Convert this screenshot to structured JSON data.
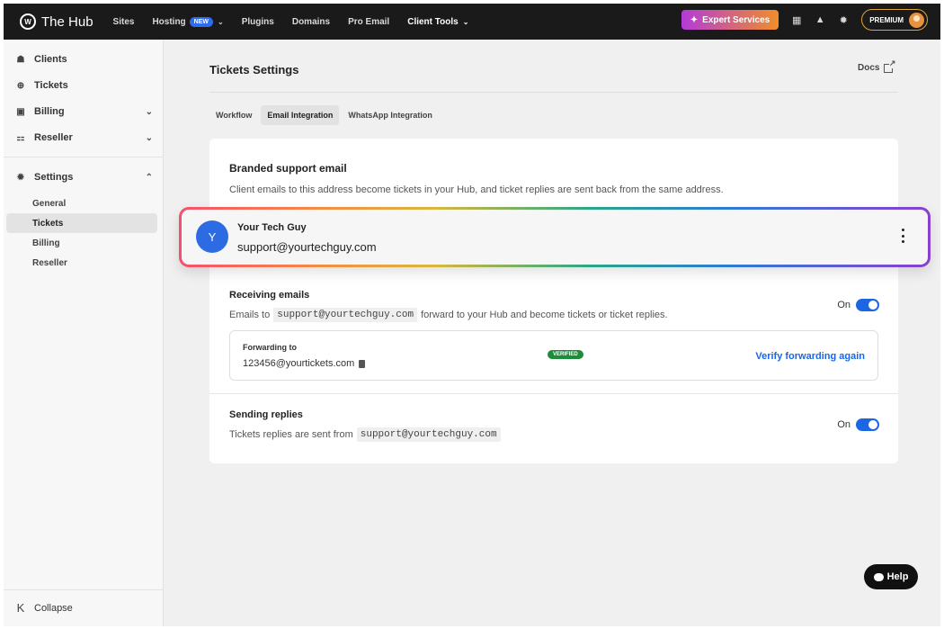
{
  "app": {
    "brand_name": "The Hub",
    "logo_text": "W"
  },
  "topnav": {
    "items": [
      {
        "label": "Sites"
      },
      {
        "label": "Hosting",
        "badge": "NEW"
      },
      {
        "label": "Plugins"
      },
      {
        "label": "Domains"
      },
      {
        "label": "Pro Email"
      },
      {
        "label": "Client Tools"
      }
    ],
    "expert_label": "Expert Services",
    "premium_label": "PREMIUM",
    "icons": [
      "gift-icon",
      "bell-icon",
      "gear-icon"
    ]
  },
  "sidebar": {
    "items": [
      {
        "label": "Clients",
        "icon": "users-icon"
      },
      {
        "label": "Tickets",
        "icon": "lifebuoy-icon"
      },
      {
        "label": "Billing",
        "icon": "invoice-icon"
      },
      {
        "label": "Reseller",
        "icon": "hierarchy-icon"
      }
    ],
    "settings": {
      "label": "Settings",
      "subitems": [
        {
          "label": "General"
        },
        {
          "label": "Tickets",
          "active": true
        },
        {
          "label": "Billing"
        },
        {
          "label": "Reseller"
        }
      ]
    },
    "collapse_label": "Collapse"
  },
  "main": {
    "title": "Tickets Settings",
    "docs_label": "Docs",
    "tabs": [
      {
        "label": "Workflow"
      },
      {
        "label": "Email Integration",
        "active": true
      },
      {
        "label": "WhatsApp Integration"
      }
    ],
    "card": {
      "title": "Branded support email",
      "description": "Client emails to this address become tickets in your Hub, and ticket replies are sent back from the same address.",
      "account": {
        "avatar_letter": "Y",
        "name": "Your Tech Guy",
        "email": "support@yourtechguy.com"
      },
      "receiving": {
        "title": "Receiving emails",
        "desc_prefix": "Emails to",
        "desc_code": "support@yourtechguy.com",
        "desc_suffix": "forward to your Hub and become tickets or ticket replies.",
        "toggle_label": "On",
        "forwarding_label": "Forwarding to",
        "forwarding_value": "123456@yourtickets.com",
        "status_badge": "VERIFIED",
        "verify_link": "Verify forwarding again"
      },
      "sending": {
        "title": "Sending replies",
        "desc_prefix": "Tickets replies are sent from",
        "desc_code": "support@yourtechguy.com",
        "toggle_label": "On"
      }
    }
  },
  "help_label": "Help",
  "colors": {
    "accent": "#1d66e3",
    "verified": "#1f8c3b",
    "topbar": "#1a1a1a"
  }
}
